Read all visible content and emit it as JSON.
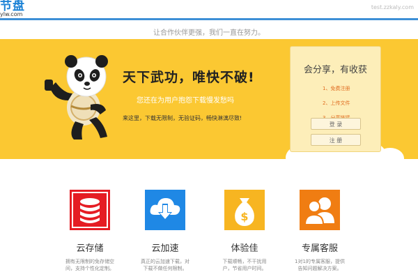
{
  "header": {
    "logo_text": "节盘",
    "logo_sub": "ylw.com",
    "login_hint": "test.zzkaly.com"
  },
  "slogan": "让合作伙伴更强，我们一直在努力。",
  "banner": {
    "headline": "天下武功，唯快不破!",
    "subline": "您还在为用户抱怨下载慢发愁吗",
    "desc": "来这里，下载无限制，无验证码，畅快淋漓尽致!"
  },
  "share": {
    "title": "会分享，有收获",
    "steps": [
      "1、免费注册",
      "2、上传文件",
      "3、分享链接"
    ],
    "login_label": "登 录",
    "register_label": "注 册"
  },
  "features": [
    {
      "title": "云存储",
      "desc": "拥有无限制的免存储空间，支持个性化定制。",
      "color": "#e51c23",
      "icon": "database-icon"
    },
    {
      "title": "云加速",
      "desc": "真正的云加速下载，对下载不做任何限制。",
      "color": "#1f88e5",
      "icon": "cloud-download-icon"
    },
    {
      "title": "体验佳",
      "desc": "下载顺畅，不干扰用户，节省用户时间。",
      "color": "#f7b521",
      "icon": "money-bag-icon"
    },
    {
      "title": "专属客服",
      "desc": "1对1的专属客服，提供告知问题解决方案。",
      "color": "#f07d12",
      "icon": "customer-service-icon"
    }
  ],
  "colors": {
    "brand_blue": "#1b82d6",
    "banner_yellow": "#fbc832",
    "accent_orange": "#e06b1f"
  }
}
